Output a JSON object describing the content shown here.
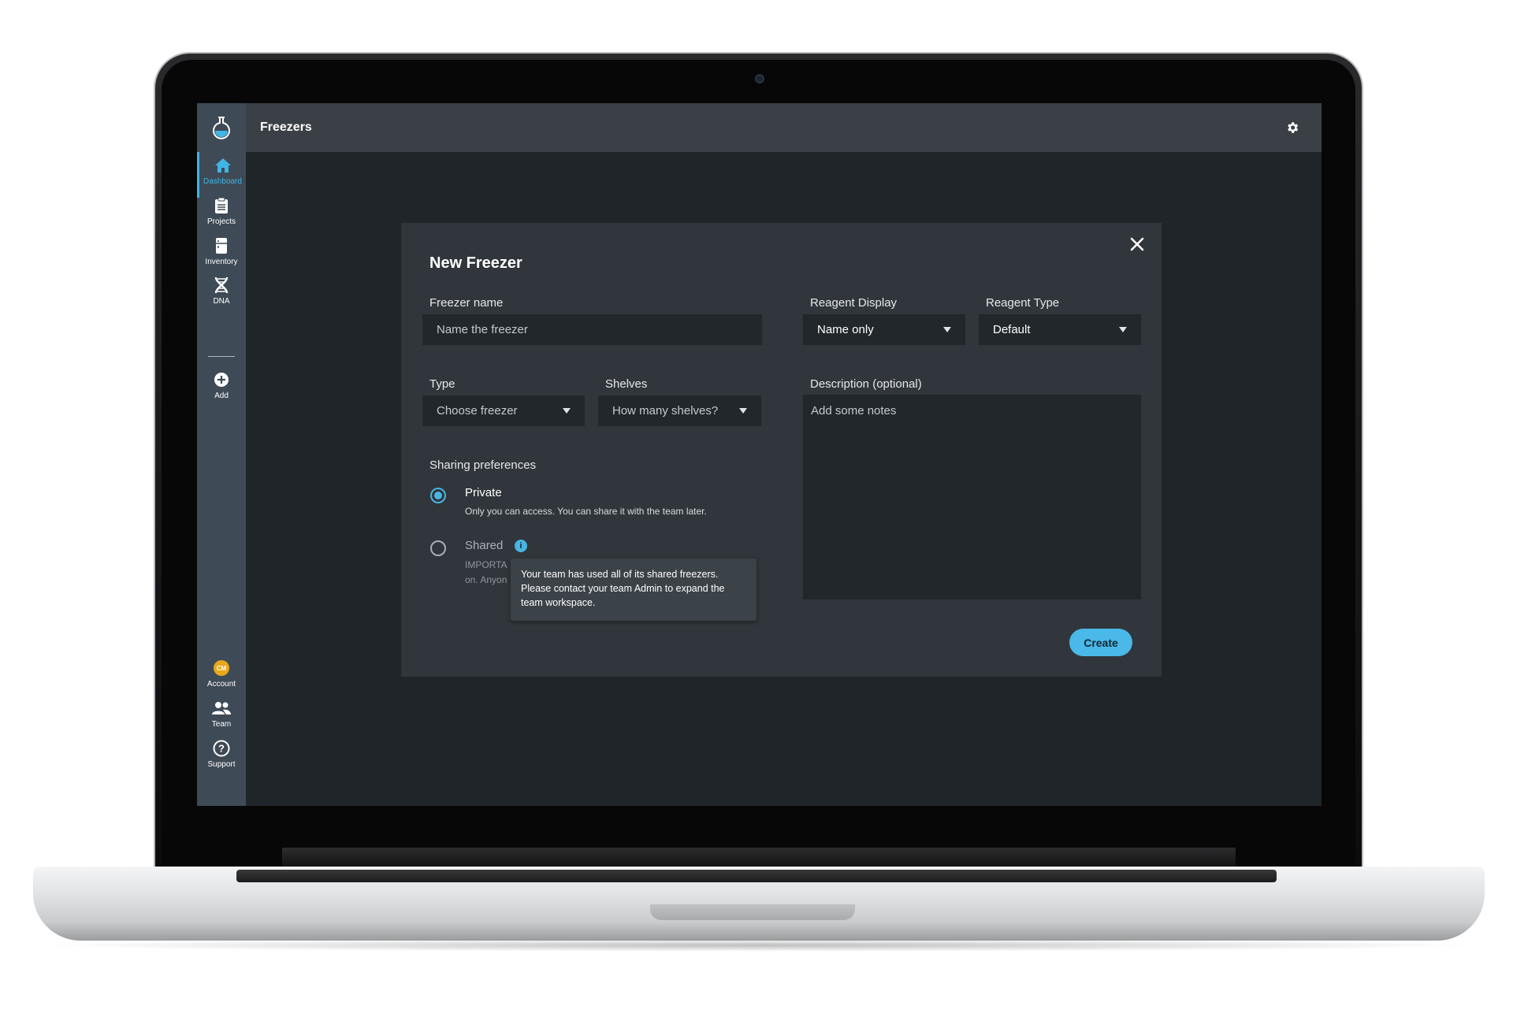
{
  "app": {
    "page_title": "Freezers"
  },
  "sidebar": {
    "items": [
      {
        "label": "Dashboard",
        "icon": "home-icon",
        "active": true
      },
      {
        "label": "Projects",
        "icon": "clipboard-icon"
      },
      {
        "label": "Inventory",
        "icon": "freezer-icon"
      },
      {
        "label": "DNA",
        "icon": "dna-icon"
      },
      {
        "label": "Add",
        "icon": "plus-circle-icon"
      },
      {
        "label": "Account",
        "icon": "avatar-icon",
        "initials": "CM"
      },
      {
        "label": "Team",
        "icon": "team-icon"
      },
      {
        "label": "Support",
        "icon": "help-icon"
      }
    ]
  },
  "modal": {
    "title": "New Freezer",
    "freezer_name": {
      "label": "Freezer name",
      "placeholder": "Name the freezer"
    },
    "reagent_display": {
      "label": "Reagent Display",
      "value": "Name only"
    },
    "reagent_type": {
      "label": "Reagent Type",
      "value": "Default"
    },
    "type": {
      "label": "Type",
      "value": "Choose freezer"
    },
    "shelves": {
      "label": "Shelves",
      "value": "How many shelves?"
    },
    "description": {
      "label": "Description (optional)",
      "placeholder": "Add some notes"
    },
    "sharing": {
      "label": "Sharing preferences",
      "private": {
        "title": "Private",
        "desc": "Only you can access. You can share it with the team later.",
        "selected": true
      },
      "shared": {
        "title": "Shared",
        "desc_line1": "IMPORTA",
        "desc_line2": "on. Anyon",
        "selected": false
      }
    },
    "tooltip": {
      "line1": "Your team has used all of its shared freezers.",
      "line2": "Please contact your team Admin to expand the",
      "line3": "team workspace."
    },
    "create_label": "Create"
  },
  "colors": {
    "accent": "#4ab8e8",
    "sidebar": "#3e4a56",
    "modal": "#30363b",
    "background": "#1f2529"
  }
}
